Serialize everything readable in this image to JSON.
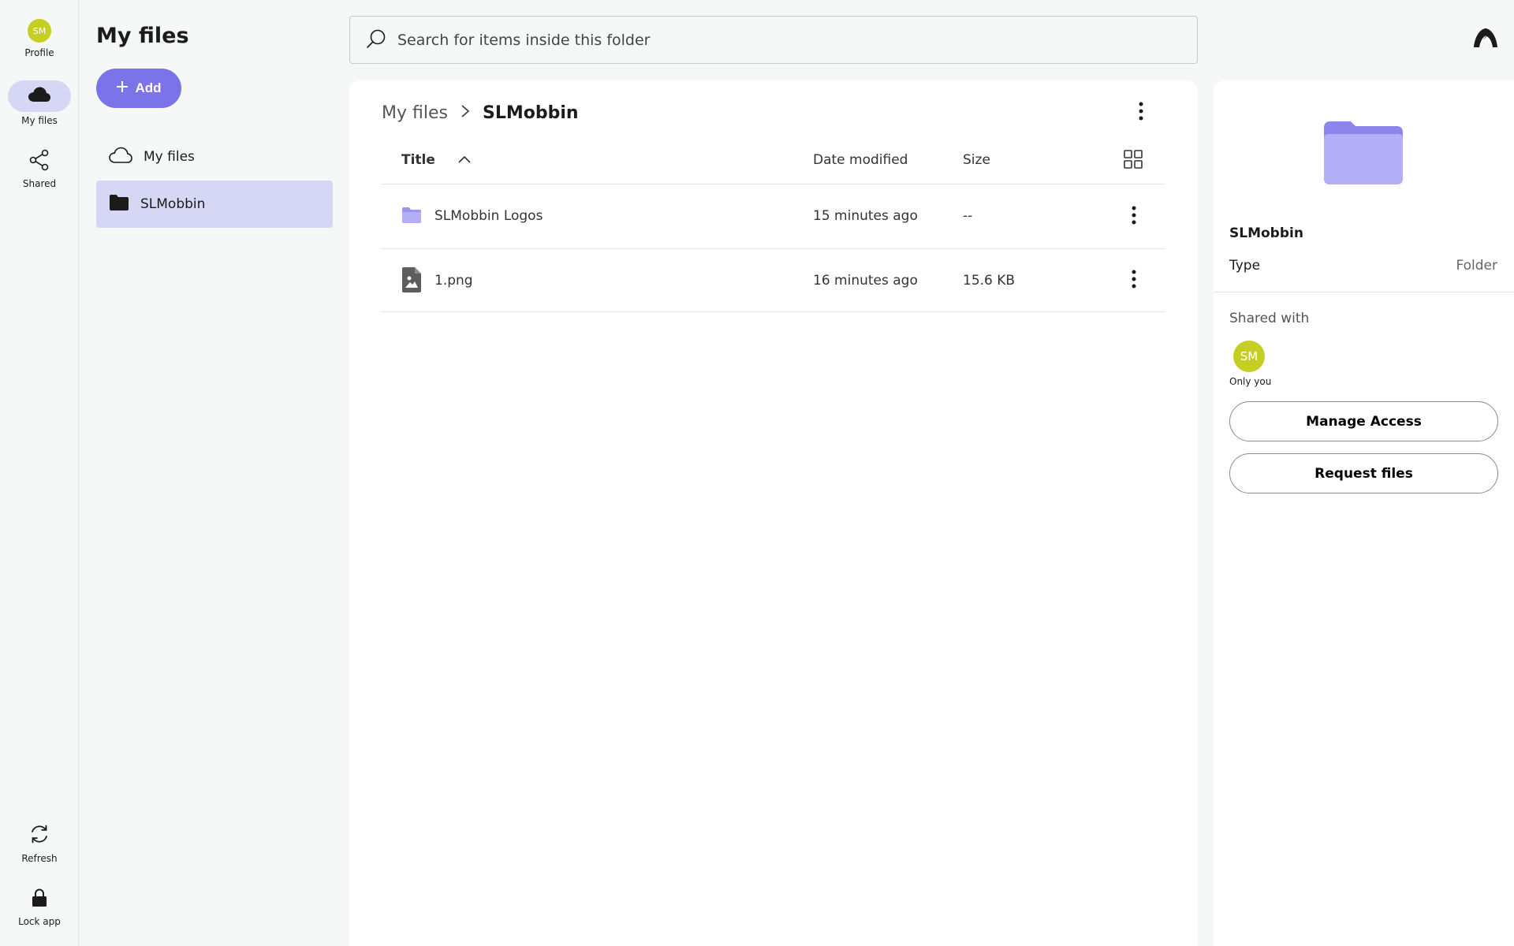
{
  "rail": {
    "profile": {
      "initials": "SM",
      "label": "Profile"
    },
    "my_files": {
      "label": "My files"
    },
    "shared": {
      "label": "Shared"
    },
    "refresh": {
      "label": "Refresh"
    },
    "lock": {
      "label": "Lock app"
    }
  },
  "nav": {
    "title": "My files",
    "add_label": "Add",
    "items": [
      {
        "label": "My files",
        "icon": "cloud-icon"
      },
      {
        "label": "SLMobbin",
        "icon": "folder-icon"
      }
    ]
  },
  "search": {
    "placeholder": "Search for items inside this folder"
  },
  "breadcrumb": {
    "root": "My files",
    "current": "SLMobbin"
  },
  "table": {
    "headers": {
      "title": "Title",
      "date": "Date modified",
      "size": "Size"
    },
    "rows": [
      {
        "name": "SLMobbin Logos",
        "date": "15 minutes ago",
        "size": "--",
        "icon": "folder-icon"
      },
      {
        "name": "1.png",
        "date": "16 minutes ago",
        "size": "15.6 KB",
        "icon": "image-file-icon"
      }
    ]
  },
  "details": {
    "name": "SLMobbin",
    "type_label": "Type",
    "type_value": "Folder",
    "shared_with_label": "Shared with",
    "avatar_initials": "SM",
    "only_you": "Only you",
    "manage_access": "Manage Access",
    "request_files": "Request files"
  },
  "colors": {
    "accent": "#7b73e8",
    "selected_bg": "#d6d6f5",
    "avatar": "#c5cf23",
    "folder": "#b3aef5"
  }
}
